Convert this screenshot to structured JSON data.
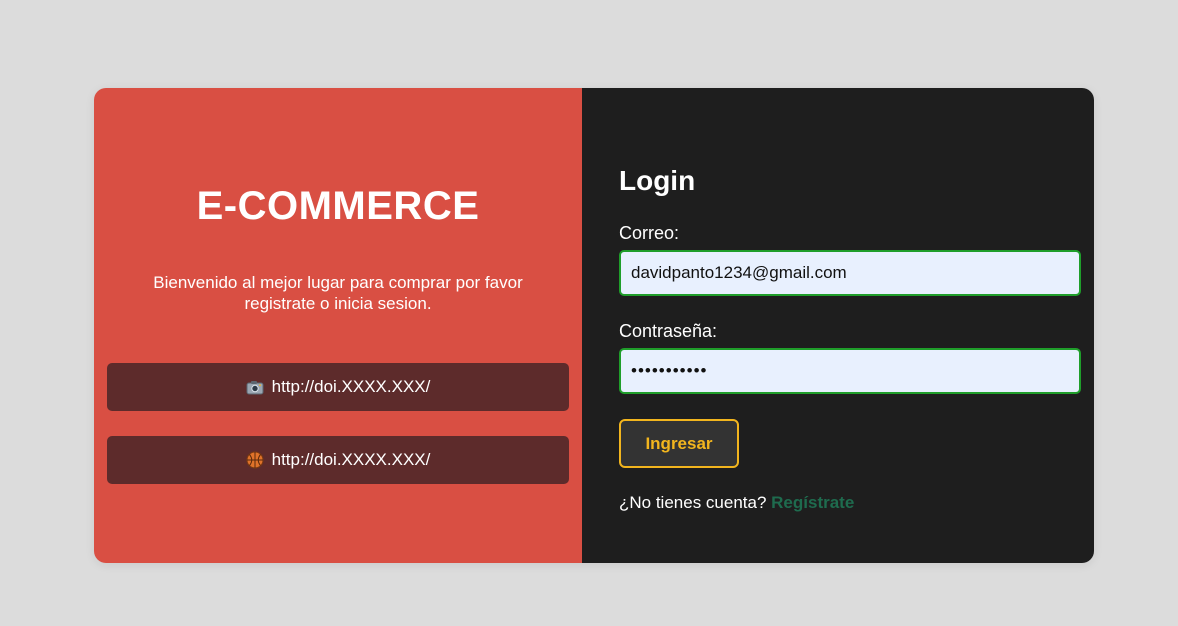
{
  "left_panel": {
    "brand": "E-COMMERCE",
    "welcome_text": "Bienvenido al mejor lugar para comprar por favor registrate o inicia sesion.",
    "links": [
      {
        "icon": "camera-icon",
        "label": "http://doi.XXXX.XXX/"
      },
      {
        "icon": "basketball-icon",
        "label": "http://doi.XXXX.XXX/"
      }
    ]
  },
  "login": {
    "title": "Login",
    "email_label": "Correo:",
    "email_value": "davidpanto1234@gmail.com",
    "password_label": "Contraseña:",
    "password_value": "•••••••••••",
    "submit_label": "Ingresar",
    "register_prompt": "¿No tienes cuenta?",
    "register_link": "Regístrate"
  },
  "colors": {
    "background": "#dcdcdc",
    "left_panel": "#d94f43",
    "right_panel": "#1e1e1e",
    "link_button": "#5d2b2b",
    "input_border": "#1f9e2a",
    "input_bg": "#e8f0fe",
    "submit_accent": "#f2b51e",
    "register_link": "#1e6b4e"
  }
}
